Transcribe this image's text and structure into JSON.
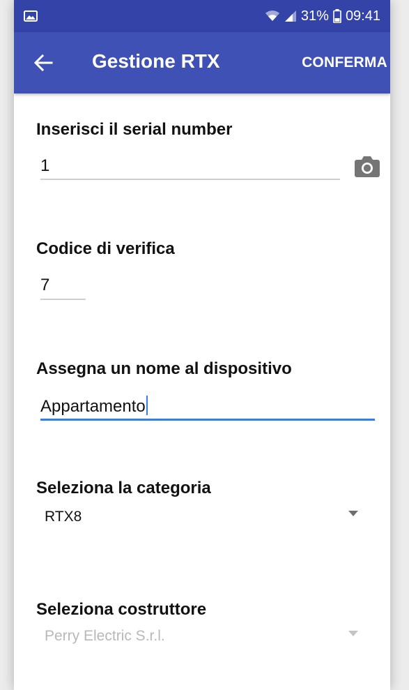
{
  "status_bar": {
    "battery": "31%",
    "time": "09:41",
    "icons": [
      "image-icon",
      "wifi-icon",
      "signal-icon",
      "battery-icon"
    ]
  },
  "app_bar": {
    "title": "Gestione RTX",
    "confirm_label": "CONFERMA",
    "back_icon": "arrow-left-icon"
  },
  "form": {
    "serial": {
      "label": "Inserisci il serial number",
      "value": "1",
      "icon": "camera-icon"
    },
    "verification": {
      "label": "Codice di verifica",
      "value": "7"
    },
    "device_name": {
      "label": "Assegna un nome al dispositivo",
      "value": "Appartamento"
    },
    "category": {
      "label": "Seleziona la categoria",
      "selected": "RTX8"
    },
    "manufacturer": {
      "label": "Seleziona costruttore",
      "selected": "Perry Electric S.r.l."
    }
  },
  "colors": {
    "status_bar": "#3343a8",
    "app_bar": "#3f51b5",
    "accent": "#2f80ed",
    "disabled_text": "#b8b8b8"
  }
}
